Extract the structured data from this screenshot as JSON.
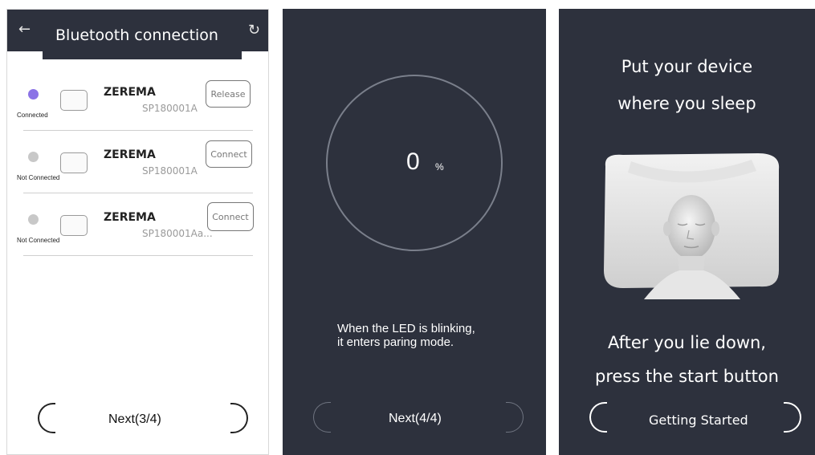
{
  "screen1": {
    "title": "Bluetooth connection",
    "back_icon": "arrow-left-icon",
    "refresh_icon": "refresh-icon",
    "devices": [
      {
        "name": "ZEREMA",
        "serial": "SP180001A",
        "status": "Connected",
        "action": "Release",
        "dot": "#8b73e6"
      },
      {
        "name": "ZEREMA",
        "serial": "SP180001A",
        "status": "Not Connected",
        "action": "Connect",
        "dot": "#c8c8c8"
      },
      {
        "name": "ZEREMA",
        "serial": "SP180001Aa...",
        "status": "Not Connected",
        "action": "Connect",
        "dot": "#c8c8c8"
      }
    ],
    "next_label": "Next(3/4)"
  },
  "screen2": {
    "progress_value": "0",
    "progress_unit": "%",
    "info_line1": "When the LED is blinking,",
    "info_line2": "it enters paring mode.",
    "next_label": "Next(4/4)"
  },
  "screen3": {
    "title_line1": "Put your device",
    "title_line2": "where you sleep",
    "bottom_line1": "After you lie down,",
    "bottom_line2": "press the start button",
    "start_label": "Getting Started"
  },
  "colors": {
    "dark_bg": "#2d313d",
    "connected_dot": "#8b73e6"
  }
}
